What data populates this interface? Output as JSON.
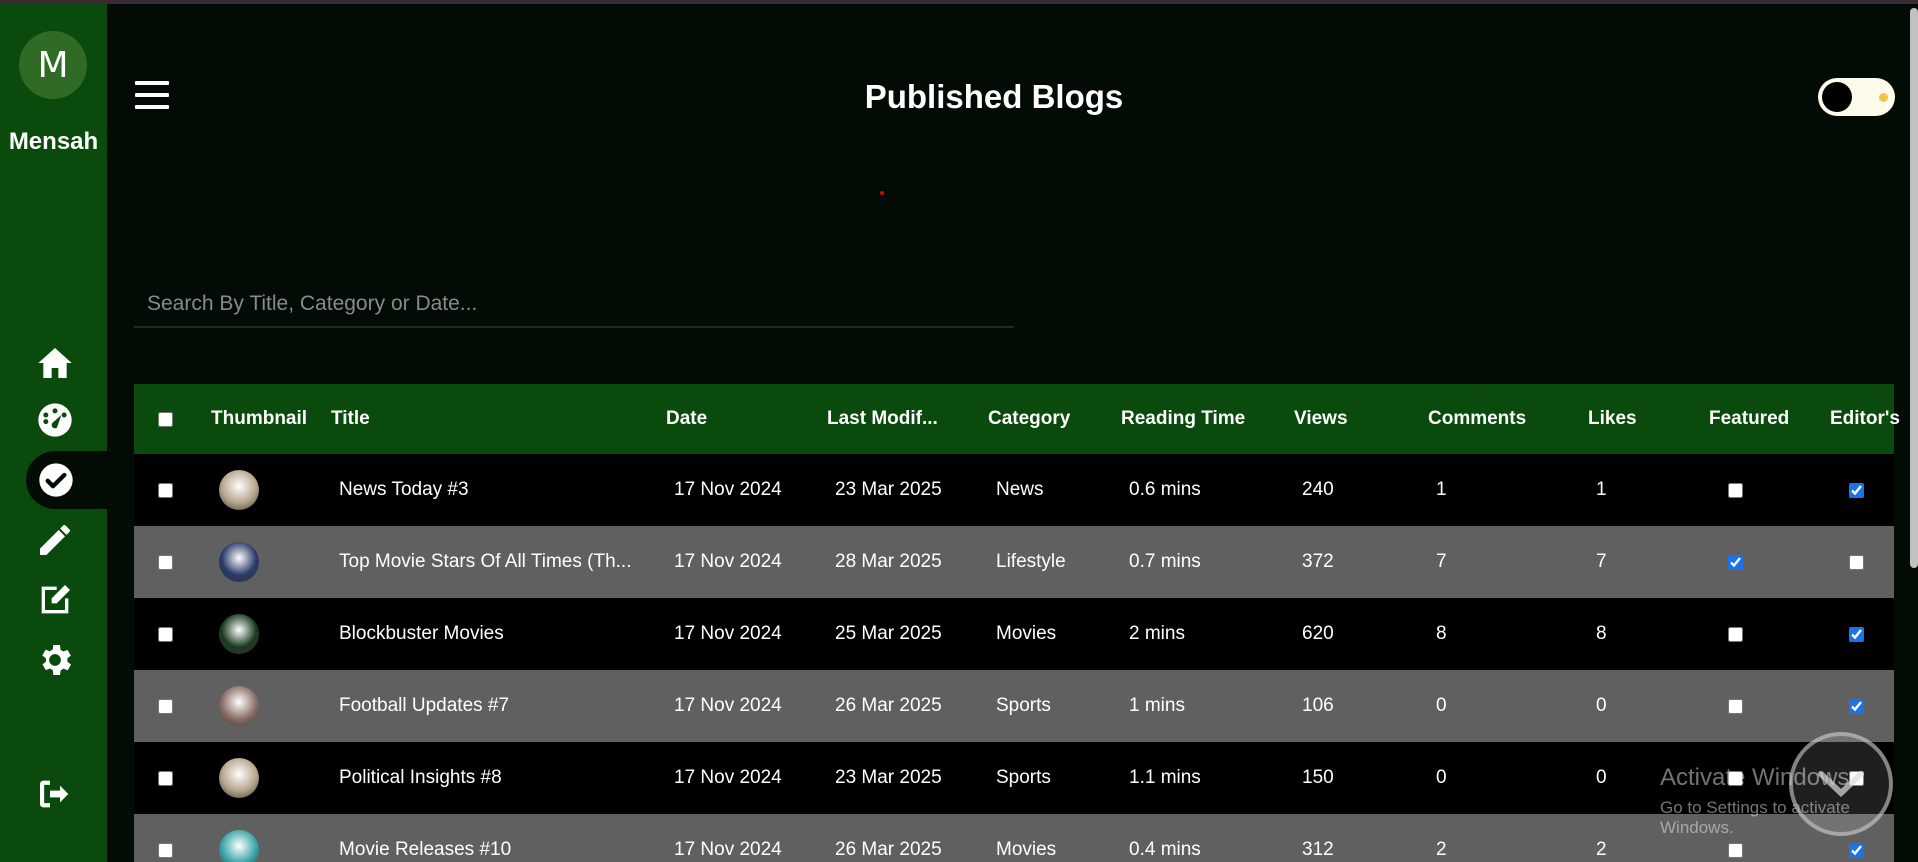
{
  "app": {
    "title": "Published Blogs",
    "user_initial": "M",
    "user_name": "Mensah"
  },
  "nav": [
    {
      "name": "home-icon"
    },
    {
      "name": "dashboard-icon"
    },
    {
      "name": "check-circle-icon",
      "active": true
    },
    {
      "name": "pencil-icon"
    },
    {
      "name": "edit-icon"
    },
    {
      "name": "gear-icon"
    },
    {
      "name": "logout-icon"
    }
  ],
  "search": {
    "placeholder": "Search By Title, Category or Date..."
  },
  "table": {
    "columns": [
      "Thumbnail",
      "Title",
      "Date",
      "Last Modif...",
      "Category",
      "Reading Time",
      "Views",
      "Comments",
      "Likes",
      "Featured",
      "Editor's"
    ],
    "rows": [
      {
        "title": "News Today #3",
        "date": "17 Nov 2024",
        "modified": "23 Mar 2025",
        "category": "News",
        "reading_time": "0.6 mins",
        "views": "240",
        "comments": "1",
        "likes": "1",
        "featured": false,
        "editors": true,
        "thumb": "#b7a58c"
      },
      {
        "title": "Top Movie Stars Of All Times (Th...",
        "date": "17 Nov 2024",
        "modified": "28 Mar 2025",
        "category": "Lifestyle",
        "reading_time": "0.7 mins",
        "views": "372",
        "comments": "7",
        "likes": "7",
        "featured": true,
        "editors": false,
        "thumb": "#2a3a6a"
      },
      {
        "title": "Blockbuster Movies",
        "date": "17 Nov 2024",
        "modified": "25 Mar 2025",
        "category": "Movies",
        "reading_time": "2 mins",
        "views": "620",
        "comments": "8",
        "likes": "8",
        "featured": false,
        "editors": true,
        "thumb": "#1b3a22"
      },
      {
        "title": "Football Updates #7",
        "date": "17 Nov 2024",
        "modified": "26 Mar 2025",
        "category": "Sports",
        "reading_time": "1 mins",
        "views": "106",
        "comments": "0",
        "likes": "0",
        "featured": false,
        "editors": true,
        "thumb": "#8a6f66"
      },
      {
        "title": "Political Insights #8",
        "date": "17 Nov 2024",
        "modified": "23 Mar 2025",
        "category": "Sports",
        "reading_time": "1.1 mins",
        "views": "150",
        "comments": "0",
        "likes": "0",
        "featured": false,
        "editors": false,
        "thumb": "#b7a58c"
      },
      {
        "title": "Movie Releases #10",
        "date": "17 Nov 2024",
        "modified": "26 Mar 2025",
        "category": "Movies",
        "reading_time": "0.4 mins",
        "views": "312",
        "comments": "2",
        "likes": "2",
        "featured": false,
        "editors": true,
        "thumb": "#3aa5a8"
      }
    ]
  },
  "watermark": {
    "line1": "Activate Windows",
    "line2": "Go to Settings to activate Windows."
  },
  "colors": {
    "sidebar": "#0a4a0d",
    "background": "#020b04",
    "header": "#0a4a0d",
    "row_alt": "#606060"
  }
}
